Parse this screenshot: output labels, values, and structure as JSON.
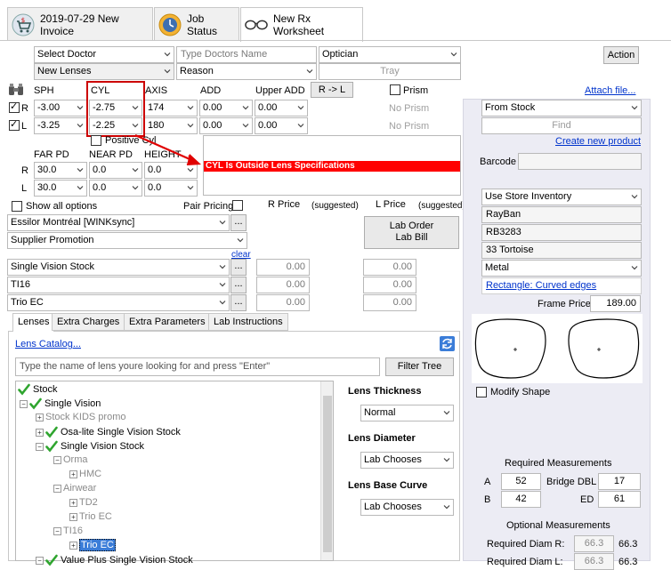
{
  "tabs": [
    {
      "label": "2019-07-29 New Invoice",
      "icon": "shopping-cart-icon"
    },
    {
      "label": "Job Status",
      "icon": "clock-icon"
    },
    {
      "label": "New Rx Worksheet",
      "icon": "glasses-icon"
    }
  ],
  "header": {
    "doctor": "Select Doctor",
    "doctor_name_placeholder": "Type Doctors Name",
    "optician": "Optician",
    "action": "Action",
    "lens_type": "New Lenses",
    "reason": "Reason",
    "tray": "Tray"
  },
  "rx": {
    "columns": [
      "SPH",
      "CYL",
      "AXIS",
      "ADD",
      "Upper ADD"
    ],
    "swap_button": "R -> L",
    "prism_label": "Prism",
    "attach_file": "Attach file...",
    "right": {
      "eye": "R",
      "sph": "-3.00",
      "cyl": "-2.75",
      "axis": "174",
      "add": "0.00",
      "upper_add": "0.00",
      "prism": "No Prism"
    },
    "left": {
      "eye": "L",
      "sph": "-3.25",
      "cyl": "-2.25",
      "axis": "180",
      "add": "0.00",
      "upper_add": "0.00",
      "prism": "No Prism"
    },
    "positive_cyl": "Positive Cyl",
    "pd_columns": [
      "FAR PD",
      "NEAR PD",
      "HEIGHT"
    ],
    "pd_right": {
      "eye": "R",
      "far": "30.0",
      "near": "0.0",
      "height": "0.0"
    },
    "pd_left": {
      "eye": "L",
      "far": "30.0",
      "near": "0.0",
      "height": "0.0"
    },
    "error_message": "CYL Is Outside Lens Specifications"
  },
  "options": {
    "show_all": "Show all options",
    "pair_pricing": "Pair Pricing",
    "r_price": "R Price",
    "l_price": "L Price",
    "suggested": "(suggested)",
    "lab": "Essilor Montréal [WINKsync]",
    "supplier_promotion": "Supplier Promotion",
    "clear": "clear",
    "lab_order": "Lab Order",
    "lab_bill": "Lab Bill",
    "items": [
      {
        "name": "Single Vision Stock",
        "r_price": "0.00",
        "l_price": "0.00"
      },
      {
        "name": "TI16",
        "r_price": "0.00",
        "l_price": "0.00"
      },
      {
        "name": "Trio EC",
        "r_price": "0.00",
        "l_price": "0.00"
      }
    ],
    "more": "..."
  },
  "lens_tabs": [
    "Lenses",
    "Extra Charges",
    "Extra Parameters",
    "Lab Instructions"
  ],
  "lens_panel": {
    "catalog_link": "Lens Catalog...",
    "search_placeholder": "Type the name of lens youre looking for and press \"Enter\"",
    "filter_button": "Filter Tree",
    "tree": [
      {
        "label": "Stock",
        "checked": true,
        "gray": false
      },
      {
        "label": "Single Vision",
        "checked": true,
        "gray": false
      },
      {
        "label": "Stock KIDS promo",
        "checked": false,
        "gray": true
      },
      {
        "label": "Osa-lite Single Vision Stock",
        "checked": true,
        "gray": false
      },
      {
        "label": "Single Vision Stock",
        "checked": true,
        "gray": false
      },
      {
        "label": "Orma",
        "checked": false,
        "gray": true
      },
      {
        "label": "HMC",
        "checked": false,
        "gray": true
      },
      {
        "label": "Airwear",
        "checked": false,
        "gray": true
      },
      {
        "label": "TD2",
        "checked": false,
        "gray": true
      },
      {
        "label": "Trio EC",
        "checked": false,
        "gray": true
      },
      {
        "label": "TI16",
        "checked": false,
        "gray": true
      },
      {
        "label": "Trio EC",
        "checked": false,
        "gray": false,
        "selected": true
      },
      {
        "label": "Value Plus Single Vision Stock",
        "checked": true,
        "gray": false
      }
    ],
    "thickness_label": "Lens Thickness",
    "thickness_value": "Normal",
    "diameter_label": "Lens Diameter",
    "diameter_value": "Lab Chooses",
    "base_curve_label": "Lens Base Curve",
    "base_curve_value": "Lab Chooses"
  },
  "frame": {
    "source": "From Stock",
    "find": "Find",
    "create_product": "Create new product",
    "barcode_label": "Barcode",
    "inventory": "Use Store Inventory",
    "brand": "RayBan",
    "model": "RB3283",
    "color": "33 Tortoise",
    "material": "Metal",
    "shape_link": "Rectangle: Curved edges",
    "price_label": "Frame Price",
    "price": "189.00",
    "modify_shape": "Modify Shape",
    "required_title": "Required Measurements",
    "a_label": "A",
    "a_value": "52",
    "bridge_label": "Bridge DBL",
    "bridge_value": "17",
    "b_label": "B",
    "b_value": "42",
    "ed_label": "ED",
    "ed_value": "61",
    "optional_title": "Optional Measurements",
    "diam_r_label": "Required Diam R:",
    "diam_r_value": "66.3",
    "diam_r_text": "66.3",
    "diam_l_label": "Required Diam L:",
    "diam_l_value": "66.3",
    "diam_l_text": "66.3"
  },
  "colors": {
    "error_bg": "#ff0000",
    "highlight": "#cc0000",
    "link": "#0033cc",
    "panel": "#ececf4"
  }
}
